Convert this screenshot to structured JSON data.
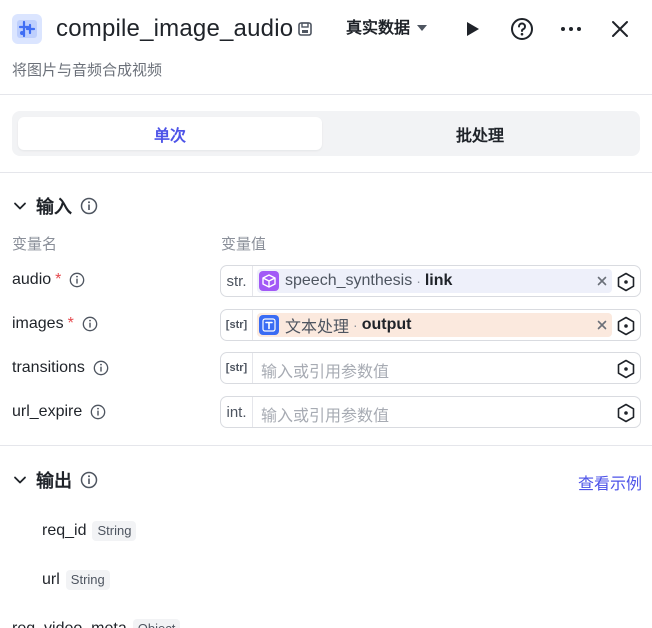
{
  "header": {
    "title": "compile_image_audio",
    "subtitle": "将图片与音频合成视频",
    "data_mode": "真实数据"
  },
  "tabs": [
    {
      "label": "单次",
      "active": true
    },
    {
      "label": "批处理",
      "active": false
    }
  ],
  "input_section": {
    "title": "输入",
    "col_name": "变量名",
    "col_value": "变量值",
    "params": [
      {
        "name": "audio",
        "required": true,
        "type": "str.",
        "ref_node": "speech_synthesis",
        "ref_output": "link"
      },
      {
        "name": "images",
        "required": true,
        "type": "[str]",
        "ref_node": "文本处理",
        "ref_output": "output"
      },
      {
        "name": "transitions",
        "required": false,
        "type": "[str]",
        "placeholder": "输入或引用参数值"
      },
      {
        "name": "url_expire",
        "required": false,
        "type": "int.",
        "placeholder": "输入或引用参数值"
      }
    ]
  },
  "output_section": {
    "title": "输出",
    "examples_link": "查看示例",
    "items": [
      {
        "name": "req_id",
        "type": "String"
      },
      {
        "name": "url",
        "type": "String"
      },
      {
        "name": "req_video_meta",
        "type": "Object"
      }
    ]
  },
  "colors": {
    "accent": "#4d53e8",
    "required": "#e5484d",
    "chip_purple": "#eef0fa",
    "chip_orange": "#fbe9de",
    "plugin_icon": "#a259f6",
    "text_icon": "#3a6cf4"
  }
}
